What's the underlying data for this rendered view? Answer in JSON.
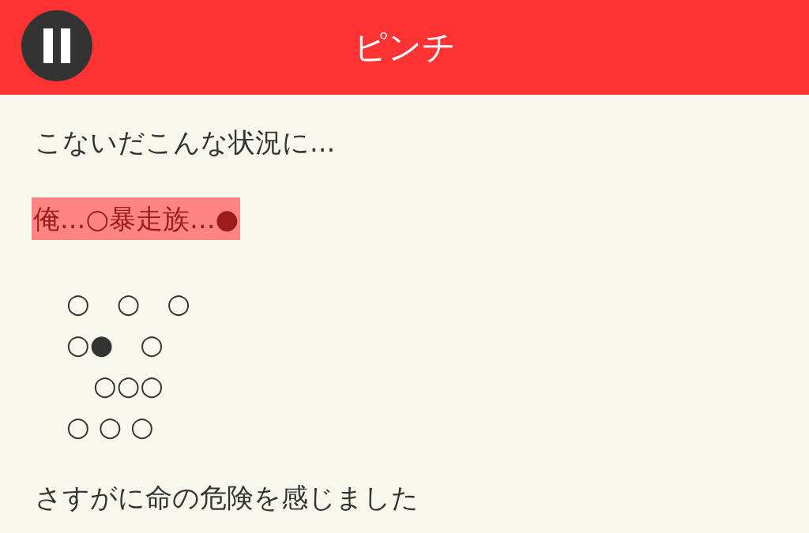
{
  "header": {
    "title": "ピンチ"
  },
  "blocks": [
    {
      "kind": "text",
      "text": "こないだこんな状況に..."
    },
    {
      "kind": "highlight",
      "text": "俺...○暴走族...●"
    },
    {
      "kind": "figure",
      "lines": [
        "○　○　○",
        "○●　○",
        "　○○○",
        "○ ○ ○"
      ]
    },
    {
      "kind": "text",
      "text": "さすがに命の危険を感じました"
    }
  ]
}
